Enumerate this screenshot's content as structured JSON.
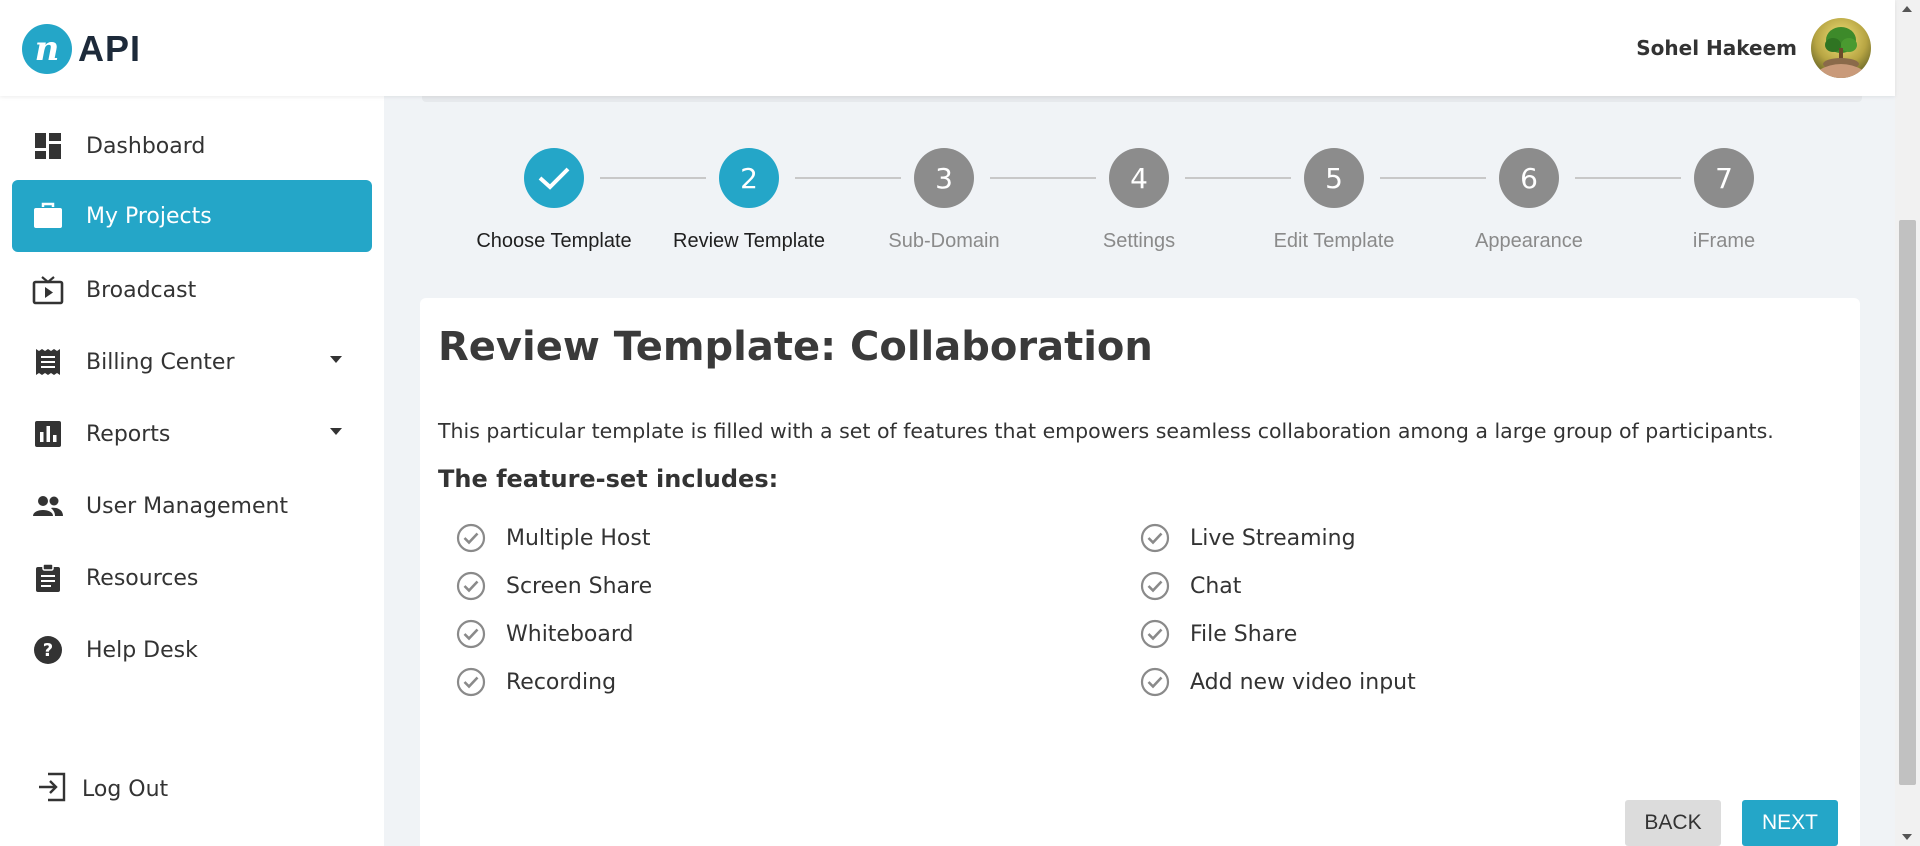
{
  "header": {
    "logo_letter": "n",
    "logo_text": "API",
    "user_name": "Sohel Hakeem"
  },
  "sidebar": {
    "items": [
      {
        "label": "Dashboard",
        "icon": "dashboard-icon"
      },
      {
        "label": "My Projects",
        "icon": "briefcase-icon",
        "active": true
      },
      {
        "label": "Broadcast",
        "icon": "tv-play-icon"
      },
      {
        "label": "Billing Center",
        "icon": "receipt-icon",
        "dropdown": true
      },
      {
        "label": "Reports",
        "icon": "bar-chart-icon",
        "dropdown": true
      },
      {
        "label": "User Management",
        "icon": "users-icon"
      },
      {
        "label": "Resources",
        "icon": "clipboard-icon"
      },
      {
        "label": "Help Desk",
        "icon": "help-circle-icon"
      }
    ],
    "logout_label": "Log Out"
  },
  "stepper": {
    "steps": [
      {
        "number": "",
        "label": "Choose Template",
        "state": "done"
      },
      {
        "number": "2",
        "label": "Review Template",
        "state": "current"
      },
      {
        "number": "3",
        "label": "Sub-Domain",
        "state": "pending"
      },
      {
        "number": "4",
        "label": "Settings",
        "state": "pending"
      },
      {
        "number": "5",
        "label": "Edit Template",
        "state": "pending"
      },
      {
        "number": "6",
        "label": "Appearance",
        "state": "pending"
      },
      {
        "number": "7",
        "label": "iFrame",
        "state": "pending"
      }
    ]
  },
  "card": {
    "title": "Review Template: Collaboration",
    "description": "This particular template is filled with a set of features that empowers seamless collaboration among a large group of participants.",
    "subtitle": "The feature-set includes:",
    "features_left": [
      "Multiple Host",
      "Screen Share",
      "Whiteboard",
      "Recording"
    ],
    "features_right": [
      "Live Streaming",
      "Chat",
      "File Share",
      "Add new video input"
    ],
    "back_label": "BACK",
    "next_label": "NEXT"
  },
  "colors": {
    "accent": "#24a6c8",
    "pending_step": "#8c8c8c",
    "background": "#f0f3f6"
  }
}
